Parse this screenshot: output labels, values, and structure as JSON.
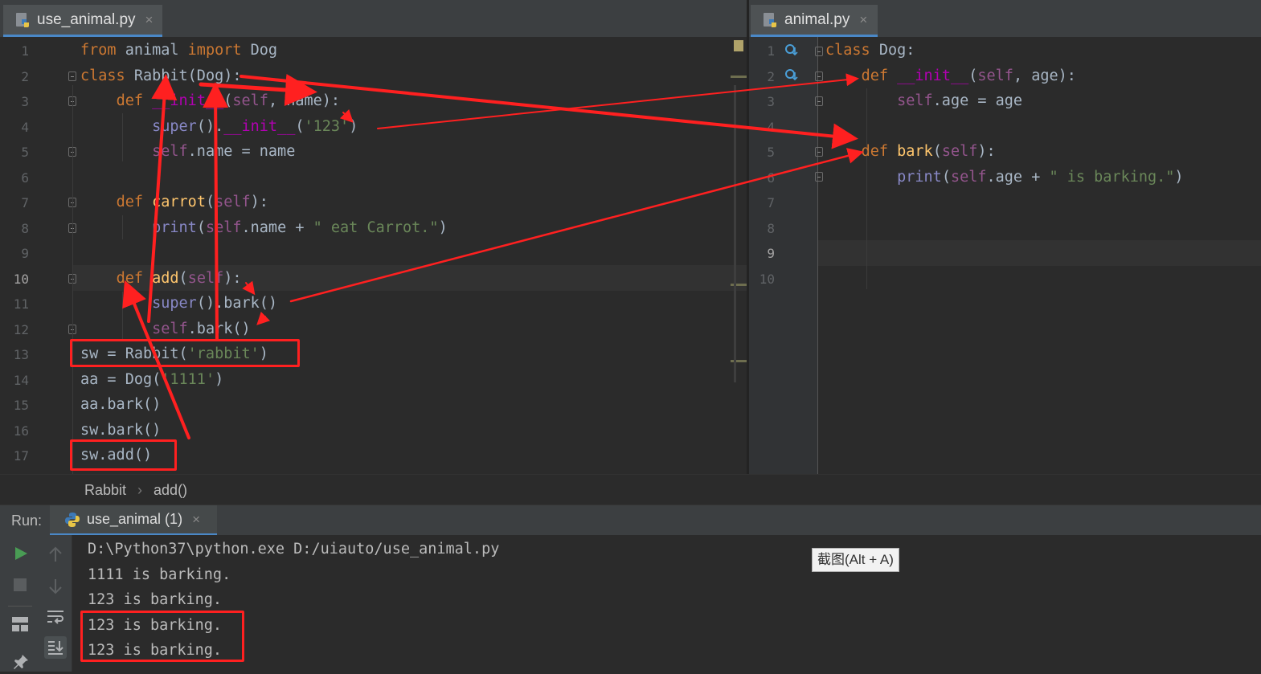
{
  "tabs": {
    "left": {
      "label": "use_animal.py",
      "close": "×"
    },
    "right": {
      "label": "animal.py",
      "close": "×"
    }
  },
  "left_editor": {
    "line_numbers": [
      "1",
      "2",
      "3",
      "4",
      "5",
      "6",
      "7",
      "8",
      "9",
      "10",
      "11",
      "12",
      "13",
      "14",
      "15",
      "16",
      "17"
    ],
    "current_line": "10"
  },
  "right_editor": {
    "line_numbers": [
      "1",
      "2",
      "3",
      "4",
      "5",
      "6",
      "7",
      "8",
      "9",
      "10"
    ],
    "current_line": "9"
  },
  "breadcrumb": {
    "class": "Rabbit",
    "separator": "›",
    "method": "add()"
  },
  "run": {
    "label": "Run:",
    "tab_label": "use_animal (1)",
    "tab_close": "×",
    "console": [
      "D:\\Python37\\python.exe D:/uiauto/use_animal.py",
      "1111 is barking.",
      "123 is barking.",
      "123 is barking.",
      "123 is barking."
    ]
  },
  "tooltip": "截图(Alt + A)",
  "colors": {
    "annotation_red": "#ff2020",
    "keyword": "#cc7832",
    "function": "#ffc66d",
    "self": "#94558d",
    "string": "#6a8759"
  }
}
